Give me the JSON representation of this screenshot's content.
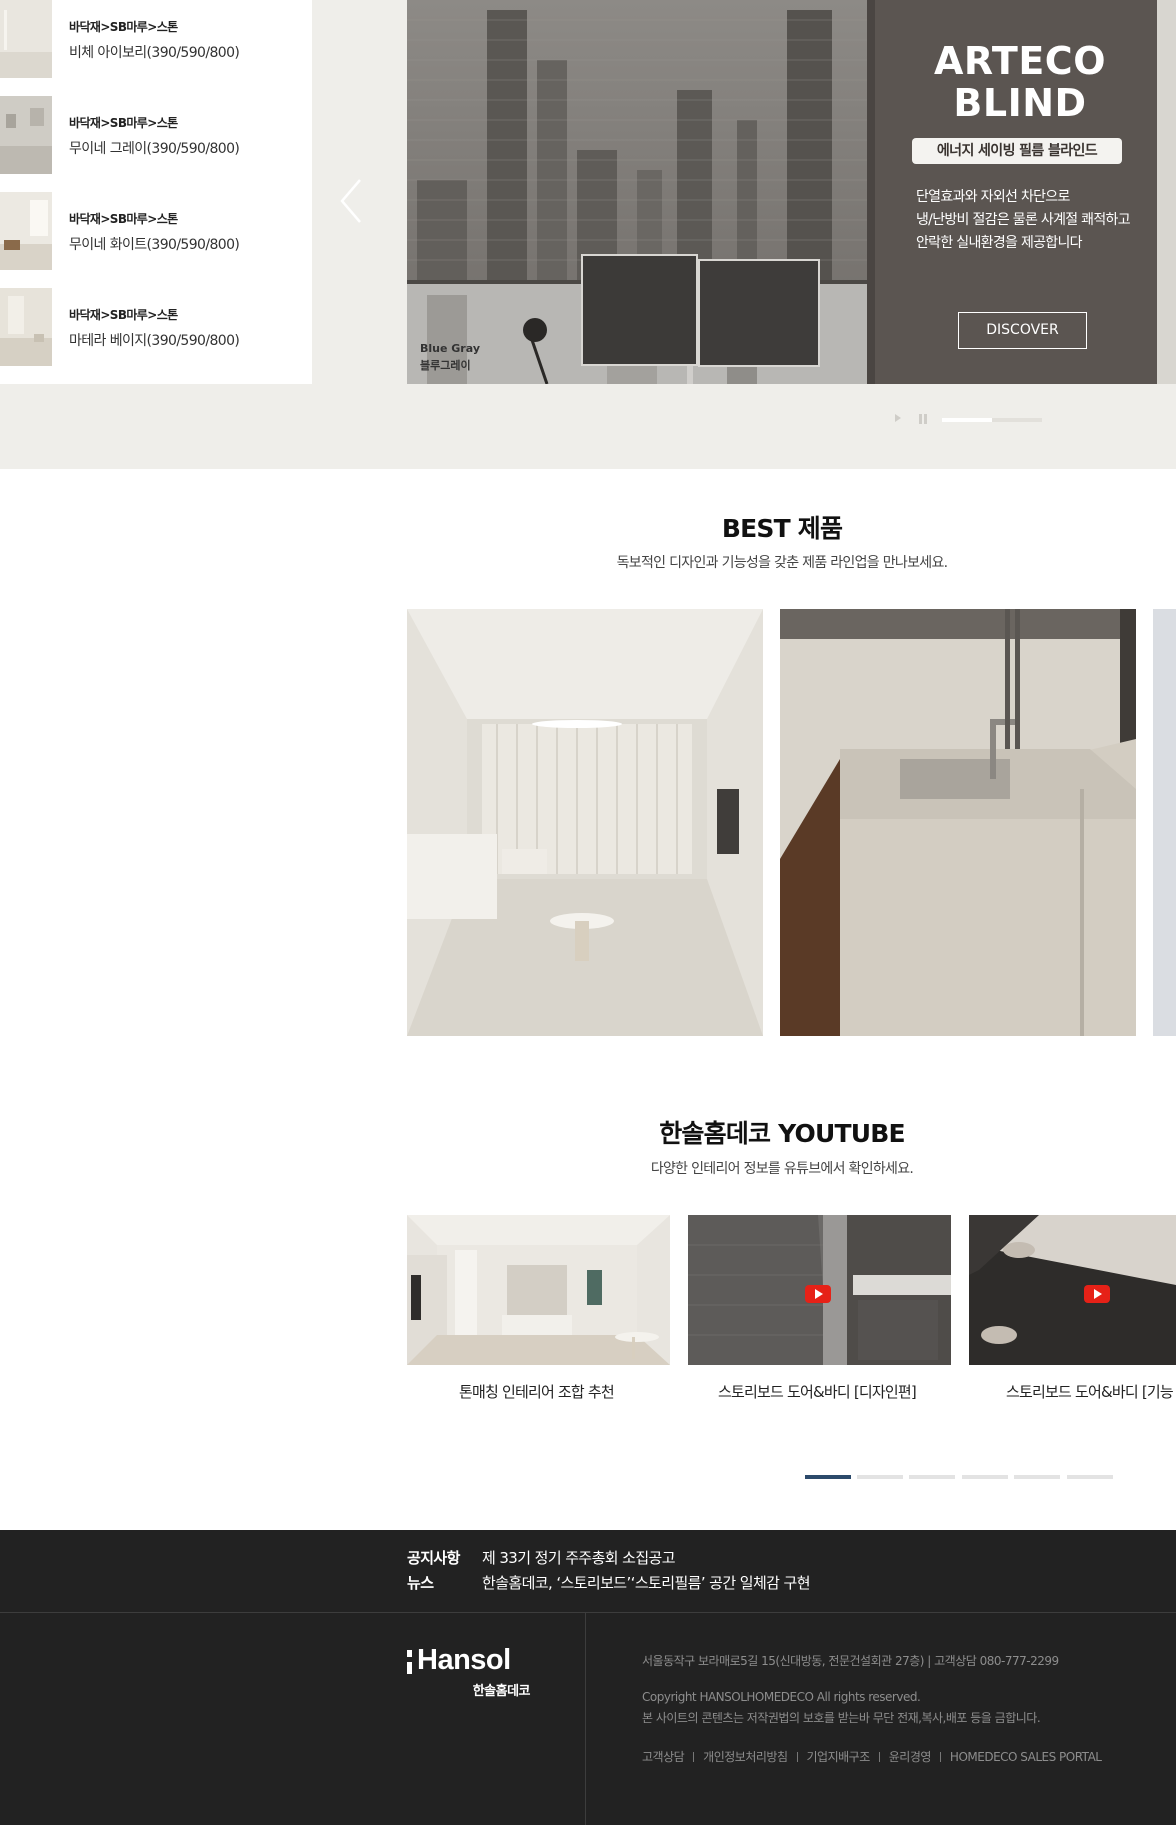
{
  "products": [
    {
      "category": "바닥재>SB마루>스톤",
      "name": "비체 아이보리(390/590/800)",
      "thumb": "ivory-stone-floor"
    },
    {
      "category": "바닥재>SB마루>스톤",
      "name": "무이네 그레이(390/590/800)",
      "thumb": "gray-stone-floor"
    },
    {
      "category": "바닥재>SB마루>스톤",
      "name": "무이네 화이트(390/590/800)",
      "thumb": "white-stone-floor"
    },
    {
      "category": "바닥재>SB마루>스톤",
      "name": "마테라 베이지(390/590/800)",
      "thumb": "beige-stone-floor"
    }
  ],
  "banner": {
    "title_line1": "ARTECO",
    "title_line2": "BLIND",
    "badge": "에너지 세이빙 필름 블라인드",
    "desc_line1": "단열효과와 자외선 차단으로",
    "desc_line2": "냉/난방비 절감은 물론 사계절 쾌적하고",
    "desc_line3": "안락한 실내환경을 제공합니다",
    "button": "DISCOVER",
    "color_en": "Blue Gray",
    "color_ko": "블루그레이",
    "slide_progress": 0.5
  },
  "best": {
    "title": "BEST 제품",
    "subtitle": "독보적인 디자인과 기능성을 갖춘 제품 라인업을 만나보세요."
  },
  "youtube": {
    "title": "한솔홈데코 YOUTUBE",
    "subtitle": "다양한 인테리어 정보를 유튜브에서 확인하세요.",
    "videos": [
      {
        "label": "톤매칭 인테리어 조합 추천"
      },
      {
        "label": "스토리보드 도어&바디 [디자인편]"
      },
      {
        "label": "스토리보드 도어&바디 [기능"
      }
    ],
    "active_page": 1,
    "page_count": 6
  },
  "footer": {
    "notice_label": "공지사항",
    "notice_text": "제 33기 정기 주주총회 소집공고",
    "news_label": "뉴스",
    "news_text": "한솔홈데코, ‘스토리보드’‘스토리필름’ 공간 일체감 구현",
    "logo": "Hansol",
    "logo_sub": "한솔홈데코",
    "address": "서울동작구 보라매로5길 15(신대방동, 전문건설회관 27층)   |   고객상담 080-777-2299",
    "copyright": "Copyright HANSOLHOMEDECO All rights reserved.",
    "notice_copy": "본 사이트의 콘텐츠는 저작권법의 보호를 받는바 무단 전재,복사,배포 등을 금합니다.",
    "links": [
      "고객상담",
      "개인정보처리방침",
      "기업지배구조",
      "윤리경영",
      "HOMEDECO SALES PORTAL"
    ]
  },
  "colors": {
    "band": "#efeeea",
    "footer": "#222222",
    "pager_active": "#2c4a6b",
    "youtube_red": "#e62117"
  }
}
